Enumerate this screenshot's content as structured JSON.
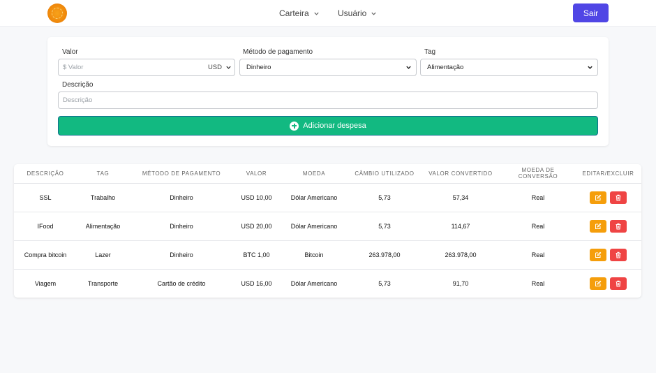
{
  "nav": {
    "menus": [
      "Carteira",
      "Usuário"
    ],
    "logout_label": "Sair"
  },
  "form": {
    "valor": {
      "label": "Valor",
      "placeholder": "$ Valor",
      "currency": "USD"
    },
    "metodo": {
      "label": "Método de pagamento",
      "selected": "Dinheiro"
    },
    "tag": {
      "label": "Tag",
      "selected": "Alimentação"
    },
    "descricao": {
      "label": "Descrição",
      "placeholder": "Descrição"
    },
    "submit_label": "Adicionar despesa"
  },
  "table": {
    "headers": [
      "Descrição",
      "Tag",
      "Método de pagamento",
      "Valor",
      "Moeda",
      "Câmbio utilizado",
      "Valor convertido",
      "Moeda de conversão",
      "Editar/Excluir"
    ],
    "rows": [
      [
        "SSL",
        "Trabalho",
        "Dinheiro",
        "USD 10,00",
        "Dólar Americano",
        "5,73",
        "57,34",
        "Real"
      ],
      [
        "IFood",
        "Alimentação",
        "Dinheiro",
        "USD 20,00",
        "Dólar Americano",
        "5,73",
        "114,67",
        "Real"
      ],
      [
        "Compra bitcoin",
        "Lazer",
        "Dinheiro",
        "BTC 1,00",
        "Bitcoin",
        "263.978,00",
        "263.978,00",
        "Real"
      ],
      [
        "Viagem",
        "Transporte",
        "Cartão de crédito",
        "USD 16,00",
        "Dólar Americano",
        "5,73",
        "91,70",
        "Real"
      ]
    ]
  },
  "colors": {
    "primary": "#5046e5",
    "success": "#12b981",
    "edit": "#f59e0b",
    "delete": "#ef4444",
    "logo": "#f08a0c"
  }
}
